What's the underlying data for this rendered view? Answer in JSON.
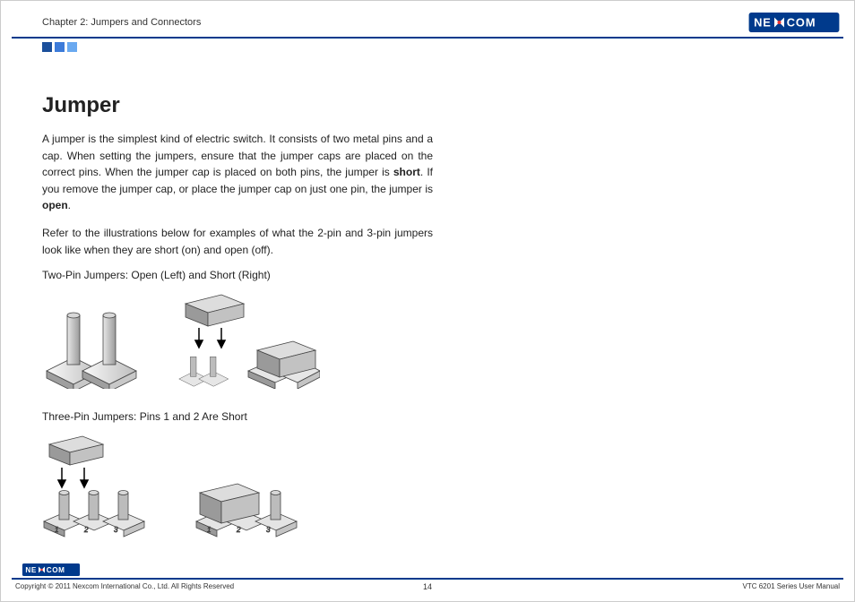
{
  "header": {
    "chapter": "Chapter 2: Jumpers and Connectors",
    "brand": "NEXCOM"
  },
  "content": {
    "title": "Jumper",
    "para1_a": "A jumper is the simplest kind of electric switch. It consists of two metal pins and a cap. When setting the jumpers, ensure that the jumper caps are placed on the correct pins. When the jumper cap is placed on both pins, the jumper is ",
    "short": "short",
    "para1_b": ". If you remove the jumper cap, or place the jumper cap on just one pin, the jumper is ",
    "open": "open",
    "para1_c": ".",
    "para2": "Refer to the illustrations below for examples of what the 2-pin and 3-pin jumpers look like when they are short (on) and open (off).",
    "caption1": "Two-Pin Jumpers: Open (Left) and Short (Right)",
    "caption2": "Three-Pin Jumpers: Pins 1 and 2 Are Short",
    "pin_labels": {
      "p1": "1",
      "p2": "2",
      "p3": "3"
    }
  },
  "footer": {
    "copyright": "Copyright © 2011 Nexcom International Co., Ltd. All Rights Reserved",
    "page_number": "14",
    "manual": "VTC 6201 Series User Manual"
  }
}
